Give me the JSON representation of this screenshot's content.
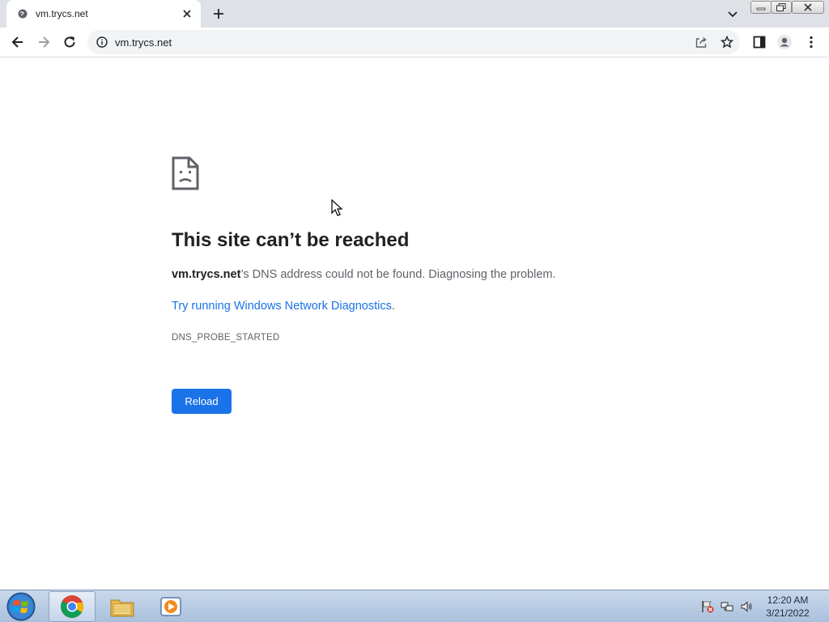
{
  "browser": {
    "tab": {
      "title": "vm.trycs.net",
      "favicon": "globe-icon",
      "close_icon": "close-icon"
    },
    "new_tab_icon": "plus-icon",
    "tab_search_icon": "chevron-down-icon",
    "window_controls": [
      "minimize-icon",
      "maximize-icon",
      "close-icon"
    ],
    "toolbar": {
      "back_icon": "arrow-left-icon",
      "forward_icon": "arrow-right-icon",
      "reload_icon": "reload-icon",
      "site_info_icon": "info-icon",
      "url": "vm.trycs.net",
      "share_icon": "share-icon",
      "bookmark_icon": "star-icon",
      "side_panel_icon": "side-panel-icon",
      "profile_icon": "profile-icon",
      "menu_icon": "more-vert-icon"
    }
  },
  "error_page": {
    "icon": "sad-page-icon",
    "title": "This site can’t be reached",
    "host": "vm.trycs.net",
    "message_rest": "’s DNS address could not be found. Diagnosing the problem.",
    "suggestion_link": "Try running Windows Network Diagnostics",
    "suggestion_end": ".",
    "error_code": "DNS_PROBE_STARTED",
    "reload_label": "Reload"
  },
  "taskbar": {
    "start_icon": "windows-start-icon",
    "apps": [
      "chrome-icon",
      "file-explorer-icon",
      "media-player-icon"
    ],
    "tray_icons": [
      "action-center-flag-icon",
      "network-icon",
      "volume-icon"
    ],
    "time": "12:20 AM",
    "date": "3/21/2022"
  }
}
